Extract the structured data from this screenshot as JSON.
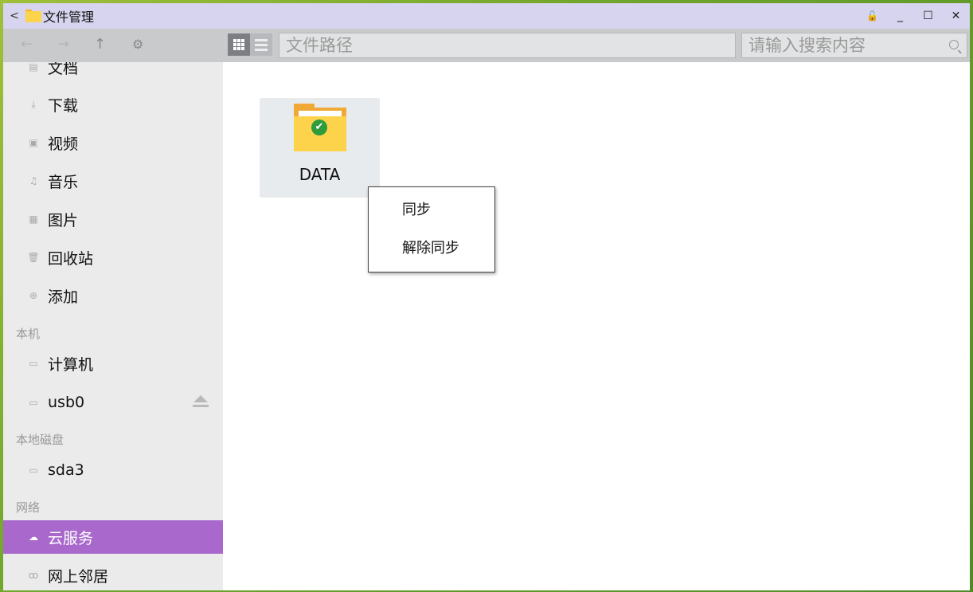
{
  "window": {
    "title": "文件管理"
  },
  "titlebar": {
    "back": "<",
    "lock": "🔓",
    "minimize": "_",
    "maximize": "☐",
    "close": "✕"
  },
  "toolbar": {
    "back": "←",
    "forward": "→",
    "up": "↑",
    "settings": "⚙",
    "path_placeholder": "文件路径",
    "search_placeholder": "请输入搜索内容"
  },
  "sidebar": {
    "items_top": [
      {
        "label": "文档",
        "icon": "document-icon"
      },
      {
        "label": "下载",
        "icon": "download-icon"
      },
      {
        "label": "视频",
        "icon": "video-icon"
      },
      {
        "label": "音乐",
        "icon": "music-icon"
      },
      {
        "label": "图片",
        "icon": "picture-icon"
      },
      {
        "label": "回收站",
        "icon": "trash-icon"
      },
      {
        "label": "添加",
        "icon": "add-icon"
      }
    ],
    "section_local": "本机",
    "local": [
      {
        "label": "计算机",
        "icon": "computer-icon"
      },
      {
        "label": "usb0",
        "icon": "drive-icon"
      }
    ],
    "section_disk": "本地磁盘",
    "disk": [
      {
        "label": "sda3",
        "icon": "drive-icon"
      }
    ],
    "section_network": "网络",
    "network": [
      {
        "label": "云服务",
        "icon": "cloud-icon",
        "active": true
      },
      {
        "label": "网上邻居",
        "icon": "network-neighborhood-icon"
      }
    ]
  },
  "main": {
    "files": [
      {
        "name": "DATA",
        "type": "folder",
        "synced": true
      }
    ]
  },
  "context_menu": {
    "items": [
      "同步",
      "解除同步"
    ]
  },
  "colors": {
    "accent": "#a868cc",
    "titlebar": "#d6d4ee",
    "folder": "#fcd34a",
    "sync_check": "#2e9b3c"
  }
}
